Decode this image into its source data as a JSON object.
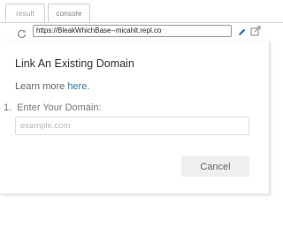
{
  "tabs": {
    "result_label": "result",
    "console_label": "console"
  },
  "browser": {
    "url": "https://BleakWhichBase--micahlt.repl.co",
    "reload_icon": "reload-icon",
    "edit_icon": "pencil-icon",
    "open_icon": "open-in-new-window-icon"
  },
  "dialog": {
    "title": "Link An Existing Domain",
    "learn_more_prefix": "Learn more ",
    "learn_more_link": "here",
    "learn_more_suffix": ".",
    "step_number": "1.",
    "step_label": "Enter Your Domain:",
    "domain_placeholder": "example.com",
    "domain_value": "",
    "cancel_label": "Cancel"
  },
  "colors": {
    "link": "#2a7ab0",
    "pencil": "#3b6fb0",
    "button_bg": "#efefef"
  }
}
